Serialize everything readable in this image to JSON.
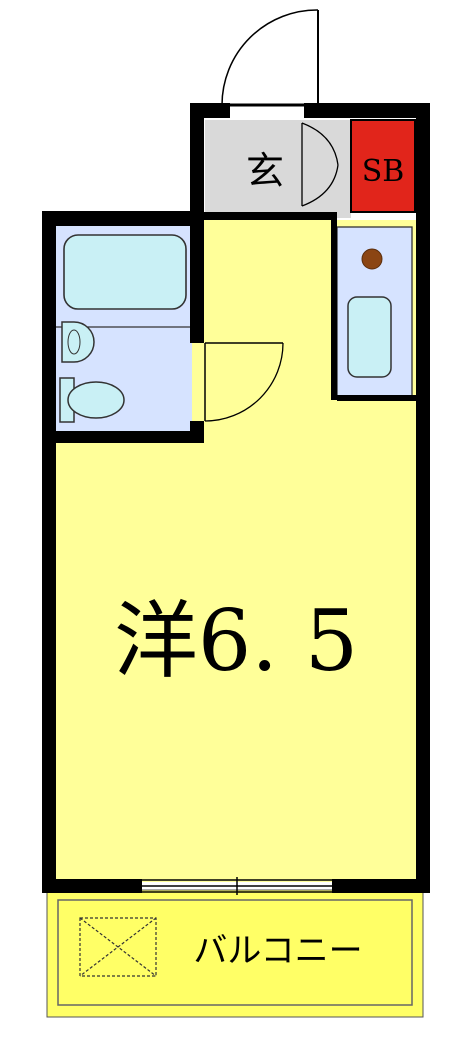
{
  "floorplan": {
    "rooms": {
      "genkan": "玄",
      "shoe_box": "SB",
      "western_room": "洋6. 5",
      "balcony": "バルコニー"
    },
    "colors": {
      "wall": "#000000",
      "western_room": "#ffff99",
      "entrance": "#d9d9d9",
      "shoe_box": "#e1251b",
      "wet_area": "#d6e3ff",
      "fixture": "#c9f0f5",
      "balcony": "#ffff66",
      "stove": "#8b4513"
    },
    "icons": {
      "balcony_drain": "crossed-square-icon"
    }
  }
}
